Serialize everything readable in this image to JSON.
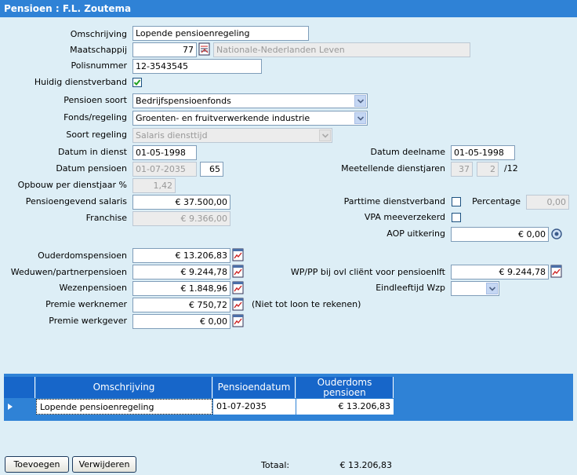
{
  "window": {
    "title": "Pensioen : F.L.  Zoutema"
  },
  "form": {
    "omschrijving": {
      "label": "Omschrijving",
      "value": "Lopende pensioenregeling"
    },
    "maatschappij": {
      "label": "Maatschappij",
      "code": "77",
      "name": "Nationale-Nederlanden Leven"
    },
    "polisnummer": {
      "label": "Polisnummer",
      "value": "12-3543545"
    },
    "huidig_dienstverband": {
      "label": "Huidig dienstverband",
      "checked": true
    },
    "pensioen_soort": {
      "label": "Pensioen soort",
      "value": "Bedrijfspensioenfonds"
    },
    "fonds_regeling": {
      "label": "Fonds/regeling",
      "value": "Groenten- en fruitverwerkende industrie"
    },
    "soort_regeling": {
      "label": "Soort regeling",
      "value": "Salaris diensttijd"
    },
    "datum_in_dienst": {
      "label": "Datum in dienst",
      "value": "01-05-1998"
    },
    "datum_pensioen": {
      "label": "Datum pensioen",
      "value": "01-07-2035",
      "age": "65"
    },
    "opbouw": {
      "label": "Opbouw per dienstjaar %",
      "value": "1,42"
    },
    "pensioengevend_salaris": {
      "label": "Pensioengevend salaris",
      "value": "€ 37.500,00"
    },
    "franchise": {
      "label": "Franchise",
      "value": "€ 9.366,00"
    },
    "datum_deelname": {
      "label": "Datum deelname",
      "value": "01-05-1998"
    },
    "meetellende_dienstjaren": {
      "label": "Meetellende dienstjaren",
      "value1": "37",
      "value2": "2",
      "suffix": "/12"
    },
    "parttime": {
      "label": "Parttime dienstverband",
      "checked": false
    },
    "percentage": {
      "label": "Percentage",
      "value": "0,00"
    },
    "vpa": {
      "label": "VPA meeverzekerd",
      "checked": false
    },
    "aop": {
      "label": "AOP uitkering",
      "value": "€ 0,00"
    },
    "ouderdomspensioen": {
      "label": "Ouderdomspensioen",
      "value": "€ 13.206,83"
    },
    "weduwen": {
      "label": "Weduwen/partnerpensioen",
      "value": "€ 9.244,78"
    },
    "wezen": {
      "label": "Wezenpensioen",
      "value": "€ 1.848,96"
    },
    "premie_werknemer": {
      "label": "Premie werknemer",
      "value": "€ 750,72",
      "note": "(Niet tot loon te rekenen)"
    },
    "premie_werkgever": {
      "label": "Premie werkgever",
      "value": "€ 0,00"
    },
    "wp_pp": {
      "label": "WP/PP bij ovl cliënt voor pensioenlft",
      "value": "€ 9.244,78"
    },
    "eindleeftijd": {
      "label": "Eindleeftijd Wzp",
      "value": ""
    }
  },
  "grid": {
    "columns": [
      "Omschrijving",
      "Pensioendatum",
      "Ouderdoms",
      "pensioen"
    ],
    "rows": [
      {
        "omschrijving": "Lopende pensioenregeling",
        "pensioendatum": "01-07-2035",
        "ouderdoms": "€ 13.206,83"
      }
    ]
  },
  "footer": {
    "add_label": "Toevoegen",
    "delete_label": "Verwijderen",
    "total_label": "Totaal:",
    "total_value": "€ 13.206,83"
  },
  "icons": {
    "calc": "calculator-icon",
    "lookup": "lookup-icon",
    "dropdown": "chevron-down-icon",
    "check": "checkmark-icon",
    "row_pointer": "row-pointer-icon"
  },
  "colors": {
    "titlebar": "#2f82d6",
    "background": "#ddeef6",
    "grid_header": "#1766c9"
  }
}
